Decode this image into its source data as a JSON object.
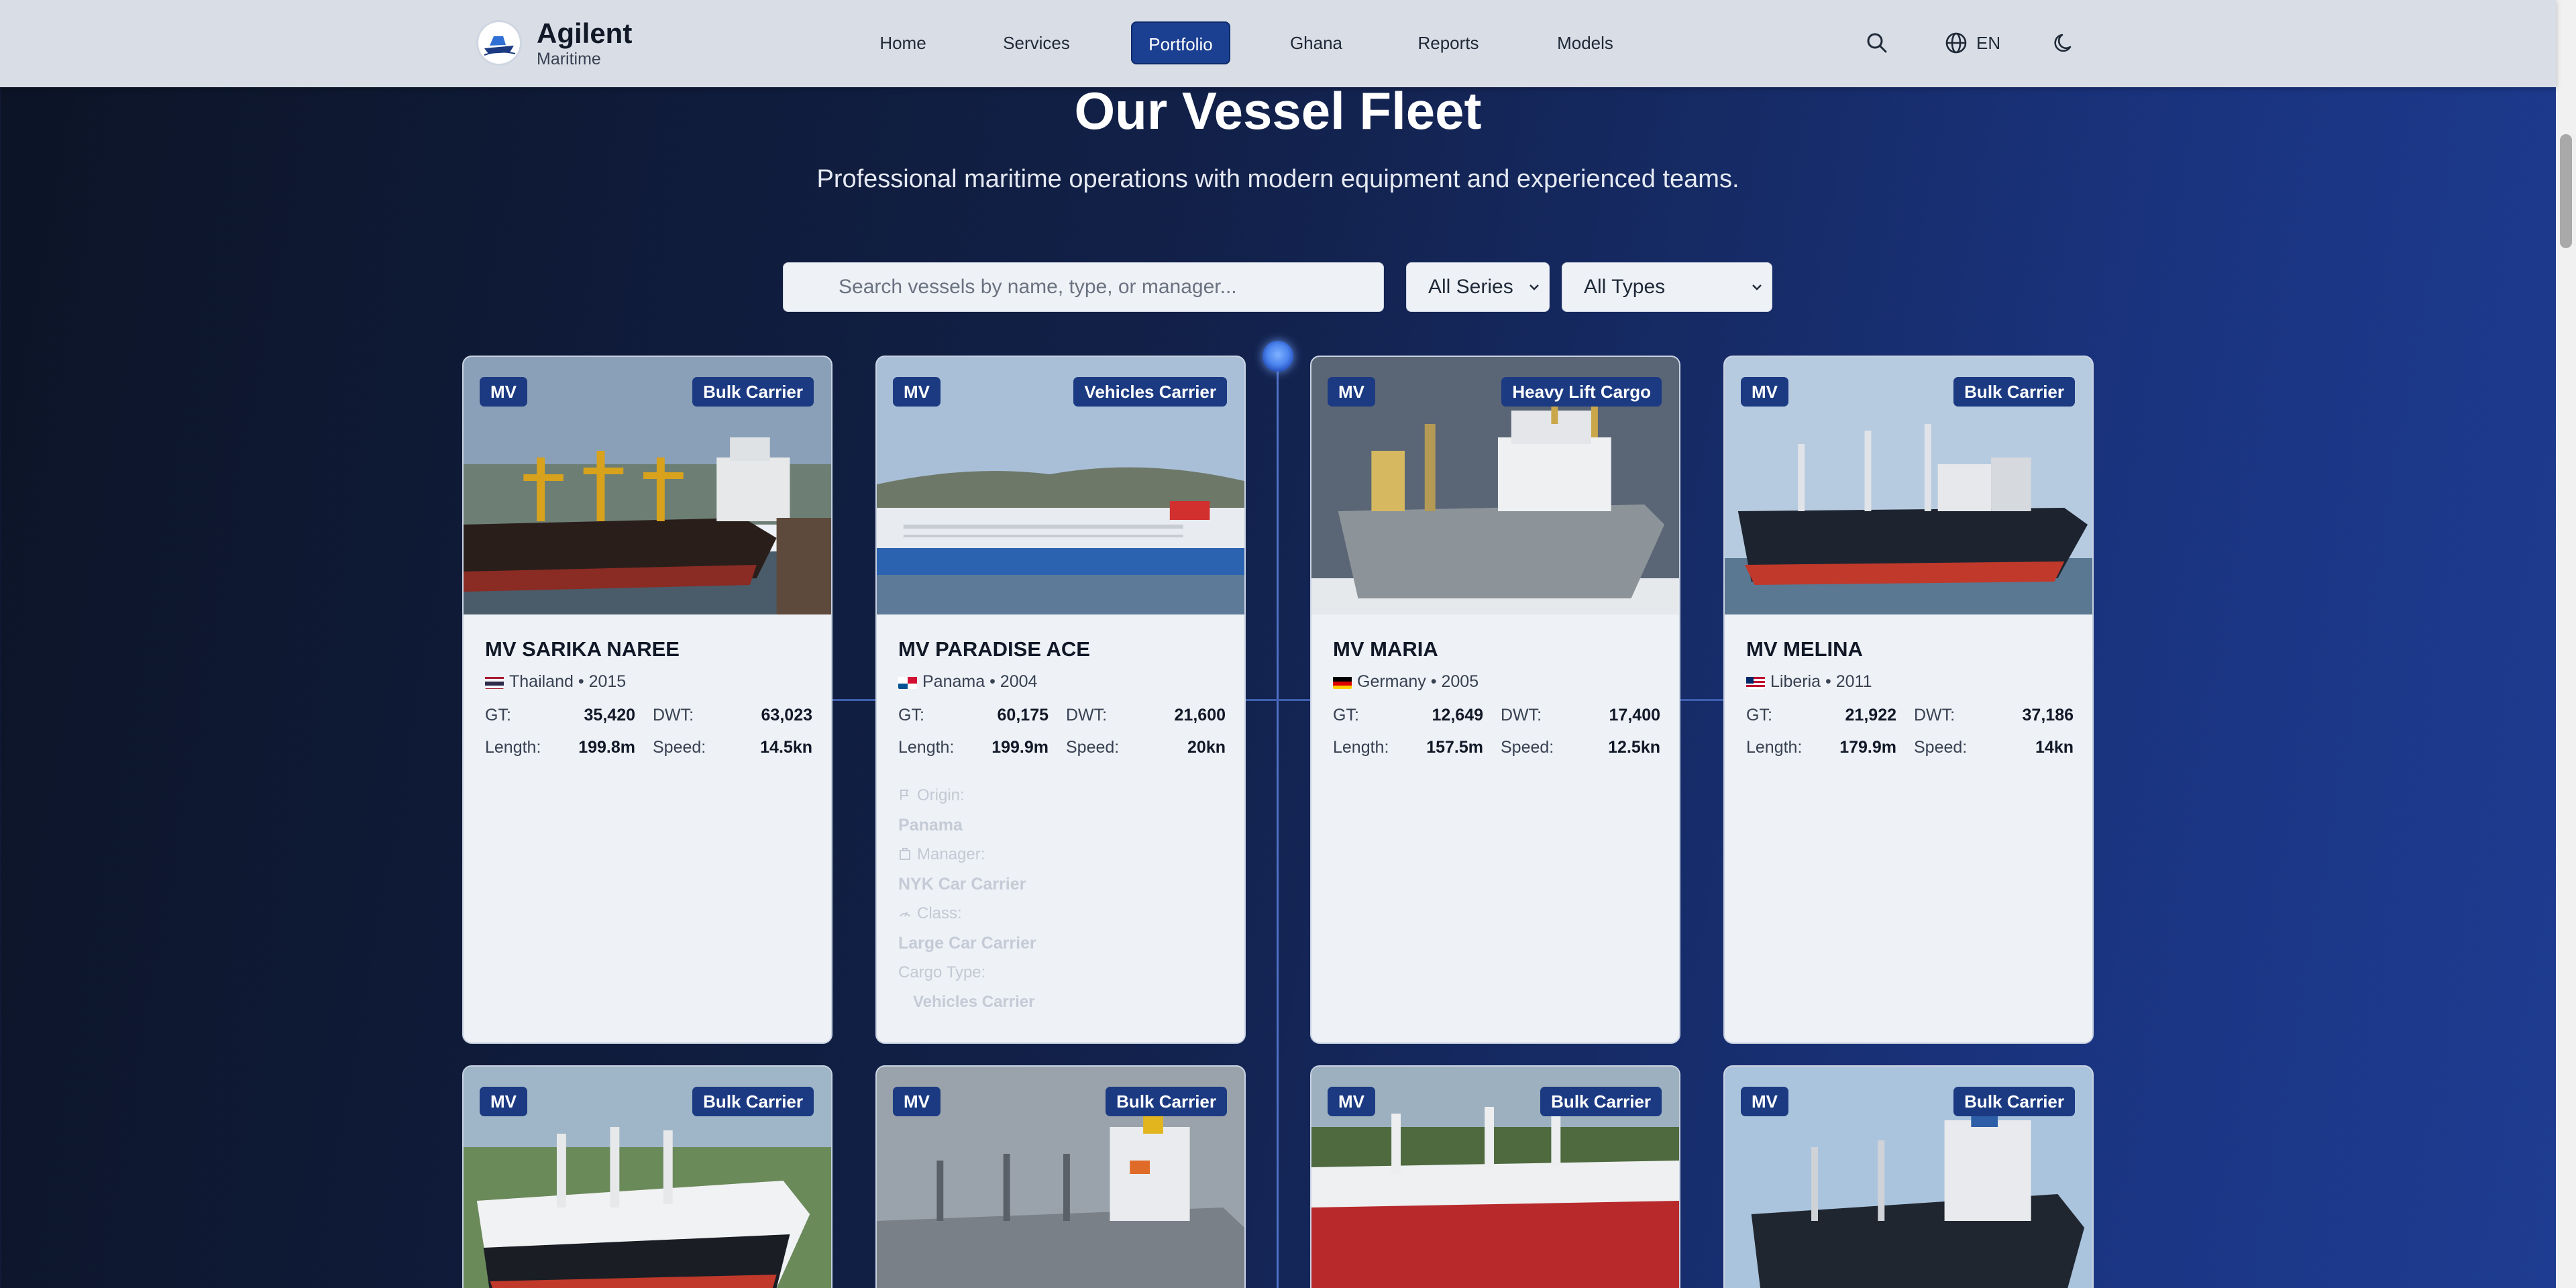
{
  "header": {
    "brand": "Agilent",
    "brand_sub": "Maritime",
    "nav": [
      {
        "label": "Home"
      },
      {
        "label": "Services"
      },
      {
        "label": "Portfolio",
        "active": true
      },
      {
        "label": "Ghana"
      },
      {
        "label": "Reports"
      },
      {
        "label": "Models"
      }
    ],
    "language": "EN",
    "icons": [
      "search-icon",
      "globe-icon",
      "moon-icon"
    ]
  },
  "hero": {
    "title": "Our Vessel Fleet",
    "subtitle": "Professional maritime operations with modern equipment and experienced teams."
  },
  "filters": {
    "search_placeholder": "Search vessels by name, type, or manager...",
    "series_value": "All Series",
    "type_value": "All Types"
  },
  "labels": {
    "gt": "GT:",
    "dwt": "DWT:",
    "length": "Length:",
    "speed": "Speed:",
    "origin": "Origin:",
    "manager": "Manager:",
    "class": "Class:",
    "cargo_type": "Cargo Type:"
  },
  "vessels": [
    {
      "prefix": "MV",
      "type": "Bulk Carrier",
      "name": "MV SARIKA NAREE",
      "country": "Thailand",
      "year": "2015",
      "gt": "35,420",
      "dwt": "63,023",
      "length": "199.8m",
      "speed": "14.5kn"
    },
    {
      "prefix": "MV",
      "type": "Vehicles Carrier",
      "name": "MV PARADISE ACE",
      "country": "Panama",
      "year": "2004",
      "gt": "60,175",
      "dwt": "21,600",
      "length": "199.9m",
      "speed": "20kn",
      "origin": "Panama",
      "manager": "NYK Car Carrier",
      "class": "Large Car Carrier",
      "cargo_type": "Vehicles Carrier"
    },
    {
      "prefix": "MV",
      "type": "Heavy Lift Cargo",
      "name": "MV MARIA",
      "country": "Germany",
      "year": "2005",
      "gt": "12,649",
      "dwt": "17,400",
      "length": "157.5m",
      "speed": "12.5kn"
    },
    {
      "prefix": "MV",
      "type": "Bulk Carrier",
      "name": "MV MELINA",
      "country": "Liberia",
      "year": "2011",
      "gt": "21,922",
      "dwt": "37,186",
      "length": "179.9m",
      "speed": "14kn"
    },
    {
      "prefix": "MV",
      "type": "Bulk Carrier"
    },
    {
      "prefix": "MV",
      "type": "Bulk Carrier"
    },
    {
      "prefix": "MV",
      "type": "Bulk Carrier"
    },
    {
      "prefix": "MV",
      "type": "Bulk Carrier"
    }
  ],
  "meta_sep": "•"
}
